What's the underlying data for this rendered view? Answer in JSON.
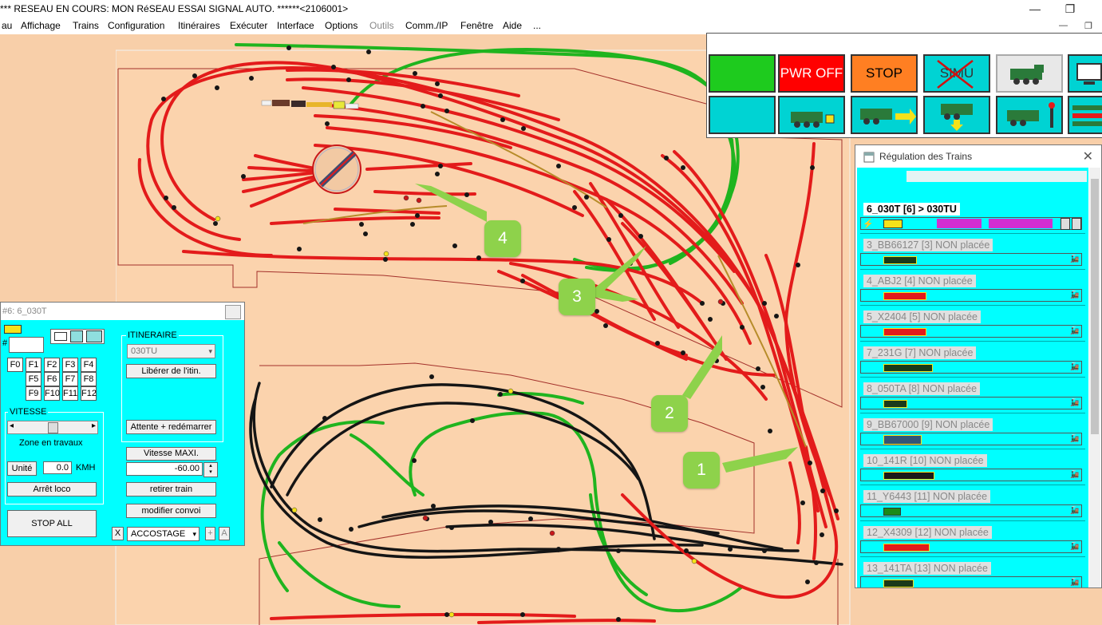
{
  "window": {
    "title": "*** RESEAU EN COURS: MON RéSEAU ESSAI SIGNAL AUTO. ******<2106001>",
    "min_glyph": "—",
    "max_glyph": "❐",
    "mdi_min": "—",
    "mdi_max": "❐"
  },
  "menu": [
    "au",
    "Affichage",
    "Trains",
    "Configuration",
    "Itinéraires",
    "Exécuter",
    "Interface",
    "Options",
    "Outils",
    "Comm./IP",
    "Fenêtre",
    "Aide",
    "..."
  ],
  "control_panel": {
    "pwr_off": "PWR OFF",
    "stop": "STOP",
    "simu": "SIMU",
    "colors": {
      "green": "#1ecb1e",
      "red": "#ff0000",
      "orange": "#ff7f22",
      "cyan": "#00d3d3"
    }
  },
  "regulation": {
    "title": "Régulation des Trains",
    "close": "✕",
    "trains": [
      {
        "label": "6_030T [6] > 030TU",
        "active": true
      },
      {
        "label": "3_BB66127 [3] NON placée",
        "active": false
      },
      {
        "label": "4_ABJ2 [4] NON placée",
        "active": false
      },
      {
        "label": "5_X2404 [5] NON placée",
        "active": false
      },
      {
        "label": "7_231G [7] NON placée",
        "active": false
      },
      {
        "label": "8_050TA [8] NON placée",
        "active": false
      },
      {
        "label": "9_BB67000 [9] NON placée",
        "active": false
      },
      {
        "label": "10_141R [10] NON placée",
        "active": false
      },
      {
        "label": "11_Y6443 [11] NON placée",
        "active": false
      },
      {
        "label": "12_X4309 [12] NON placée",
        "active": false
      },
      {
        "label": "13_141TA [13] NON placée",
        "active": false
      }
    ]
  },
  "loco_window": {
    "title": "#6: 6_030T",
    "hash": "#",
    "functions": [
      "F0",
      "F1",
      "F2",
      "F3",
      "F4",
      "F5",
      "F6",
      "F7",
      "F8",
      "F9",
      "F10",
      "F11",
      "F12"
    ],
    "vitesse_label": "VITESSE",
    "zone": "Zone en travaux",
    "unite": "Unité",
    "speed_value": "0.0",
    "speed_unit": "KMH",
    "arret": "Arrêt loco",
    "stop_all": "STOP ALL",
    "itineraire_label": "ITINERAIRE",
    "itineraire_value": "030TU",
    "liberer": "Libérer de l'itin.",
    "attente": "Attente + redémarrer",
    "vitesse_maxi": "Vitesse MAXI.",
    "vmax_value": "-60.00",
    "retirer": "retirer train",
    "modifier": "modifier convoi",
    "x_btn": "X",
    "accostage": "ACCOSTAGE",
    "plus": "+",
    "a_btn": "A"
  },
  "annotations": [
    "1",
    "2",
    "3",
    "4"
  ]
}
